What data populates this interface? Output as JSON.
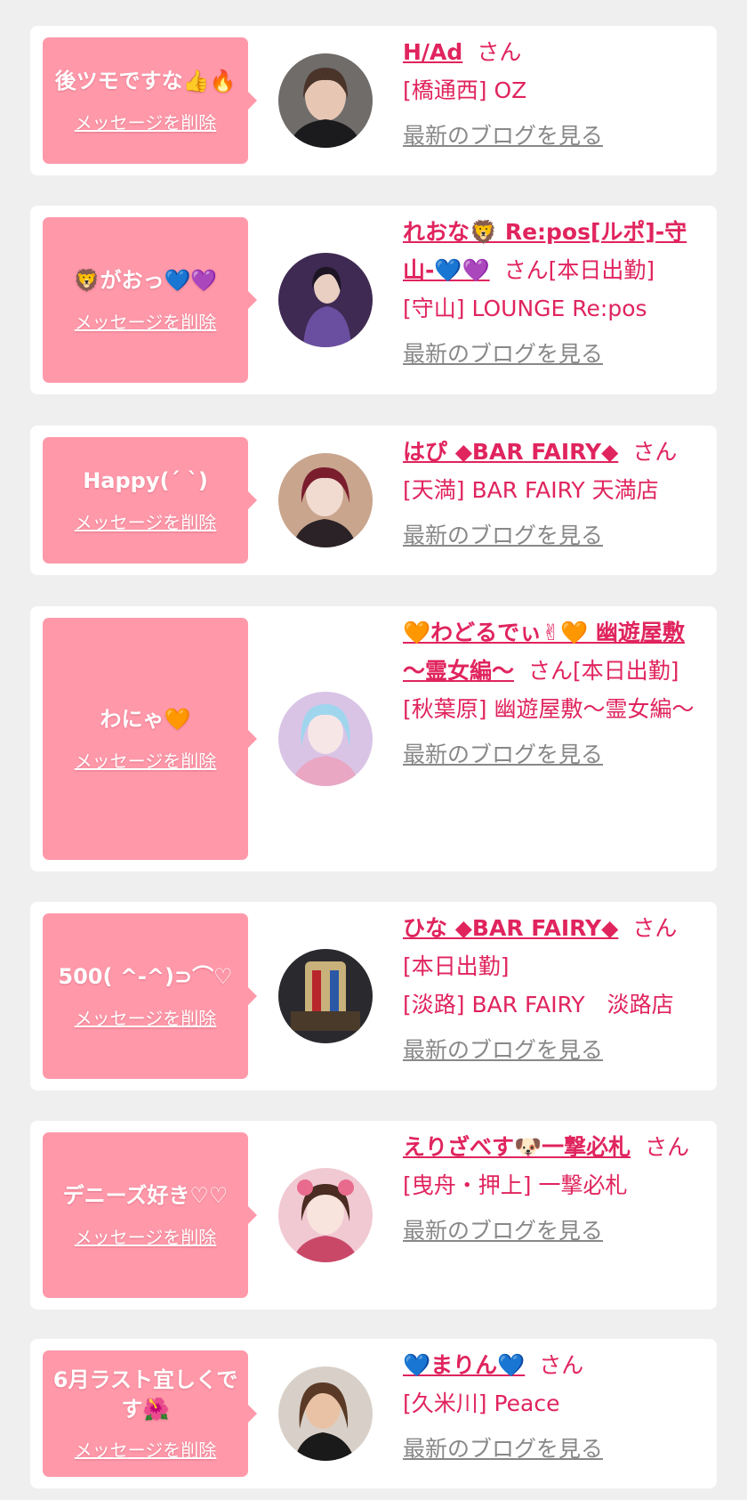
{
  "ui": {
    "delete_label": "メッセージを削除",
    "blog_label": "最新のブログを見る"
  },
  "cards": [
    {
      "message": "後ツモですな👍🔥",
      "name": "H/Ad",
      "honorific": "さん",
      "status": "",
      "store": "[橋通西] OZ"
    },
    {
      "message": "🦁がおっ💙💜",
      "name": "れおな🦁 Re:pos[ルポ]-守山-💙💜",
      "honorific": "さん",
      "status": "[本日出勤]",
      "store": "[守山] LOUNGE Re:pos"
    },
    {
      "message": "Happy(ˊ ˋ)",
      "name": "はぴ ◆BAR FAIRY◆",
      "honorific": "さん",
      "status": "",
      "store": "[天満] BAR FAIRY 天満店"
    },
    {
      "message": "わにゃ🧡",
      "name": "🧡わどるでぃ✌🧡 幽遊屋敷 ～霊女編～",
      "honorific": "さん",
      "status": "[本日出勤]",
      "store": "[秋葉原] 幽遊屋敷～霊女編～"
    },
    {
      "message": "500( ^-^)⊃⌒♡",
      "name": "ひな ◆BAR FAIRY◆",
      "honorific": "さん",
      "status": "[本日出勤]",
      "store": "[淡路] BAR FAIRY　淡路店"
    },
    {
      "message": "デニーズ好き♡♡",
      "name": "えりざべす🐶一撃必札",
      "honorific": "さん",
      "status": "",
      "store": "[曳舟・押上] 一撃必札"
    },
    {
      "message": "6月ラスト宜しくです🌺",
      "name": "💙まりん💙",
      "honorific": "さん",
      "status": "",
      "store": "[久米川] Peace"
    }
  ]
}
